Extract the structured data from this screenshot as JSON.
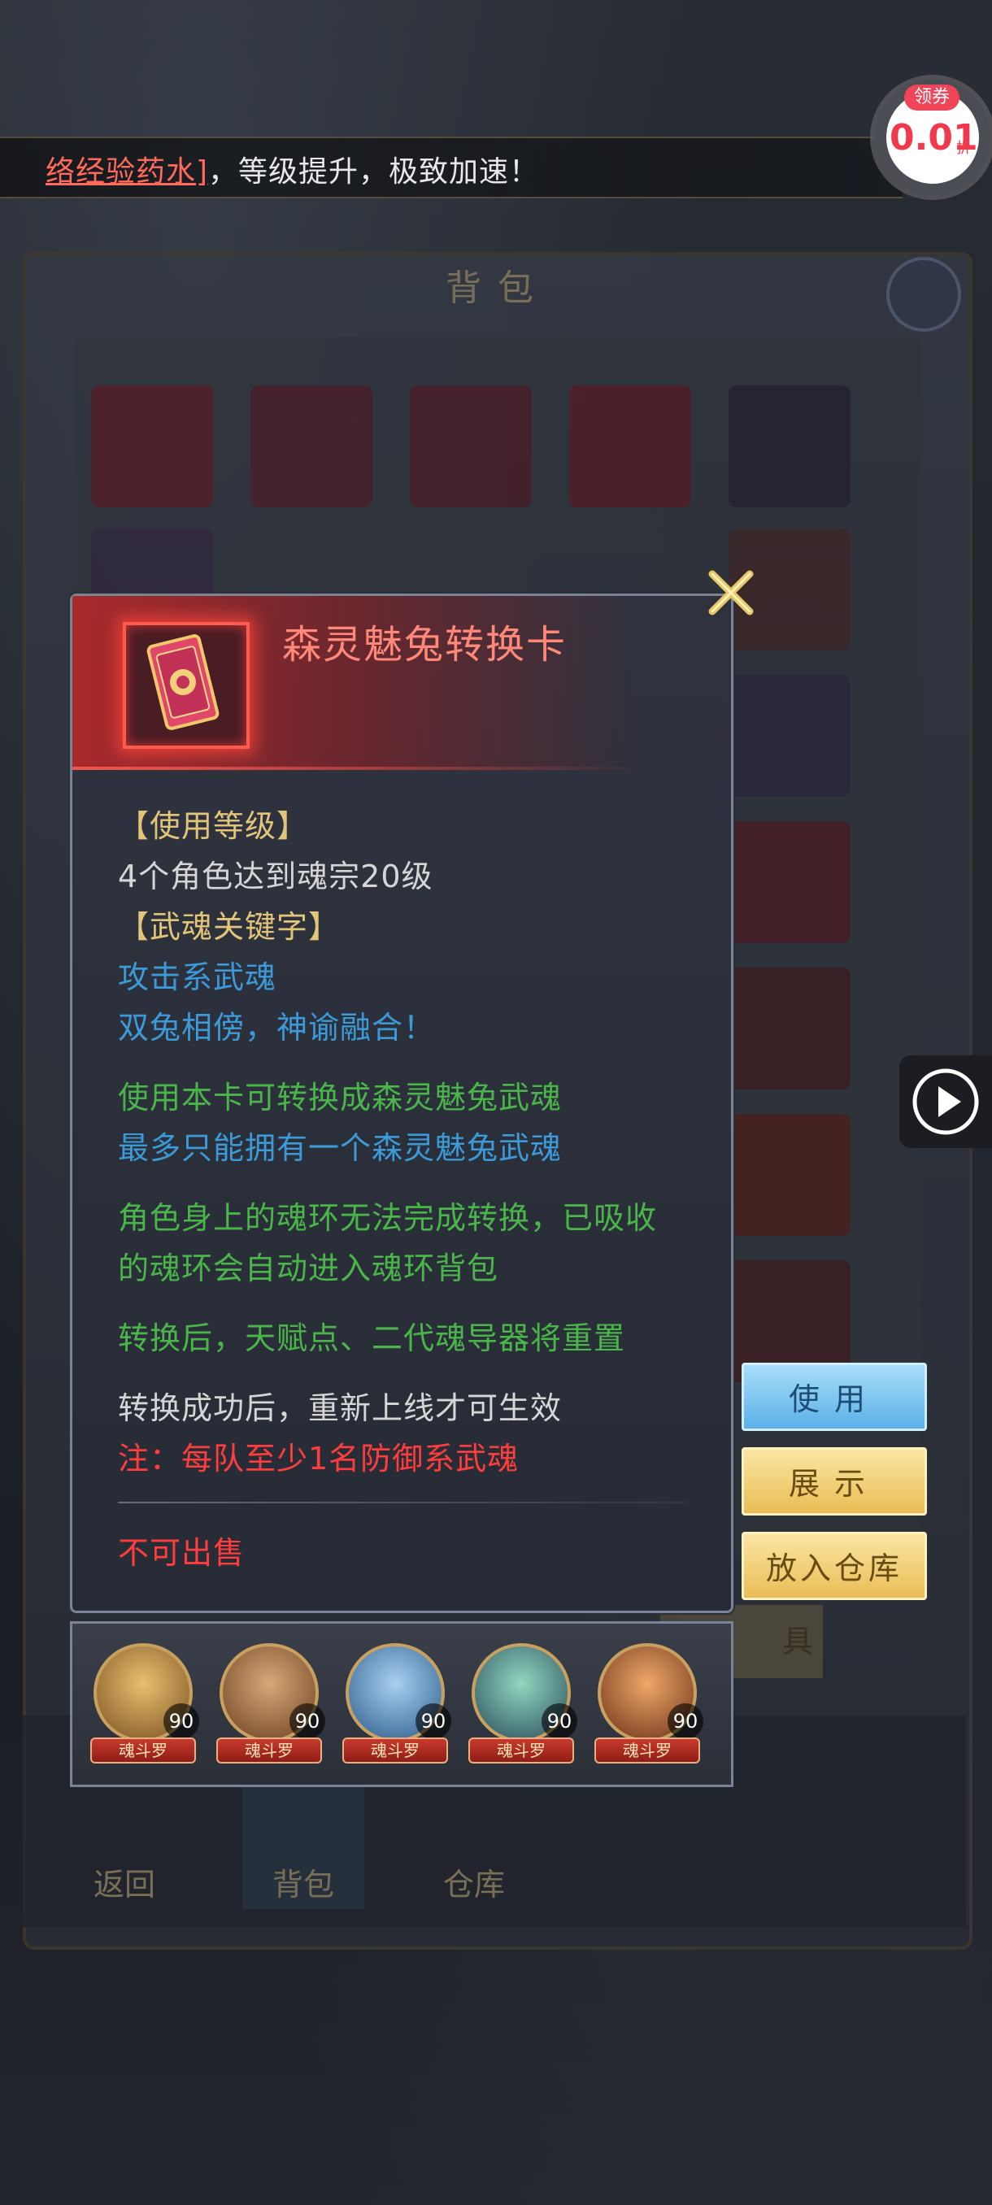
{
  "marquee": {
    "link_text": "络经验药水]",
    "rest_text": "，等级提升，极致加速！"
  },
  "coupon": {
    "tag": "领券",
    "value": "0.01",
    "unit": "折"
  },
  "bag": {
    "title": "背包",
    "action_partial": "具",
    "nav": [
      {
        "label": "返回"
      },
      {
        "label": "背包"
      },
      {
        "label": "仓库"
      }
    ]
  },
  "item": {
    "title": "森灵魅兔转换卡",
    "usage_level_header": "【使用等级】",
    "usage_level_text": "4个角色达到魂宗20级",
    "keyword_header": "【武魂关键字】",
    "keyword_type": "攻击系武魂",
    "keyword_desc": "双兔相傍，神谕融合！",
    "effect_line1": "使用本卡可转换成森灵魅兔武魂",
    "effect_line2": "最多只能拥有一个森灵魅兔武魂",
    "ring_line1": "角色身上的魂环无法完成转换，已吸收",
    "ring_line2": "的魂环会自动进入魂环背包",
    "reset_line": "转换后，天赋点、二代魂导器将重置",
    "relogin_line": "转换成功后，重新上线才可生效",
    "note_line": "注：每队至少1名防御系武魂",
    "sell_status": "不可出售"
  },
  "actions": {
    "use": "使用",
    "show": "展示",
    "store": "放入仓库"
  },
  "characters": [
    {
      "level": "90",
      "rank": "魂斗罗",
      "color": "#b8903a"
    },
    {
      "level": "90",
      "rank": "魂斗罗",
      "color": "#a06e3c"
    },
    {
      "level": "90",
      "rank": "魂斗罗",
      "color": "#4c8ab8"
    },
    {
      "level": "90",
      "rank": "魂斗罗",
      "color": "#3e8a7a"
    },
    {
      "level": "90",
      "rank": "魂斗罗",
      "color": "#b06a2a"
    }
  ],
  "colors": {
    "header_red": "#c62828",
    "gold_text": "#e3c57a",
    "blue_text": "#3c9ad8",
    "green_text": "#4ab64a",
    "red_text": "#ff3d3d"
  }
}
